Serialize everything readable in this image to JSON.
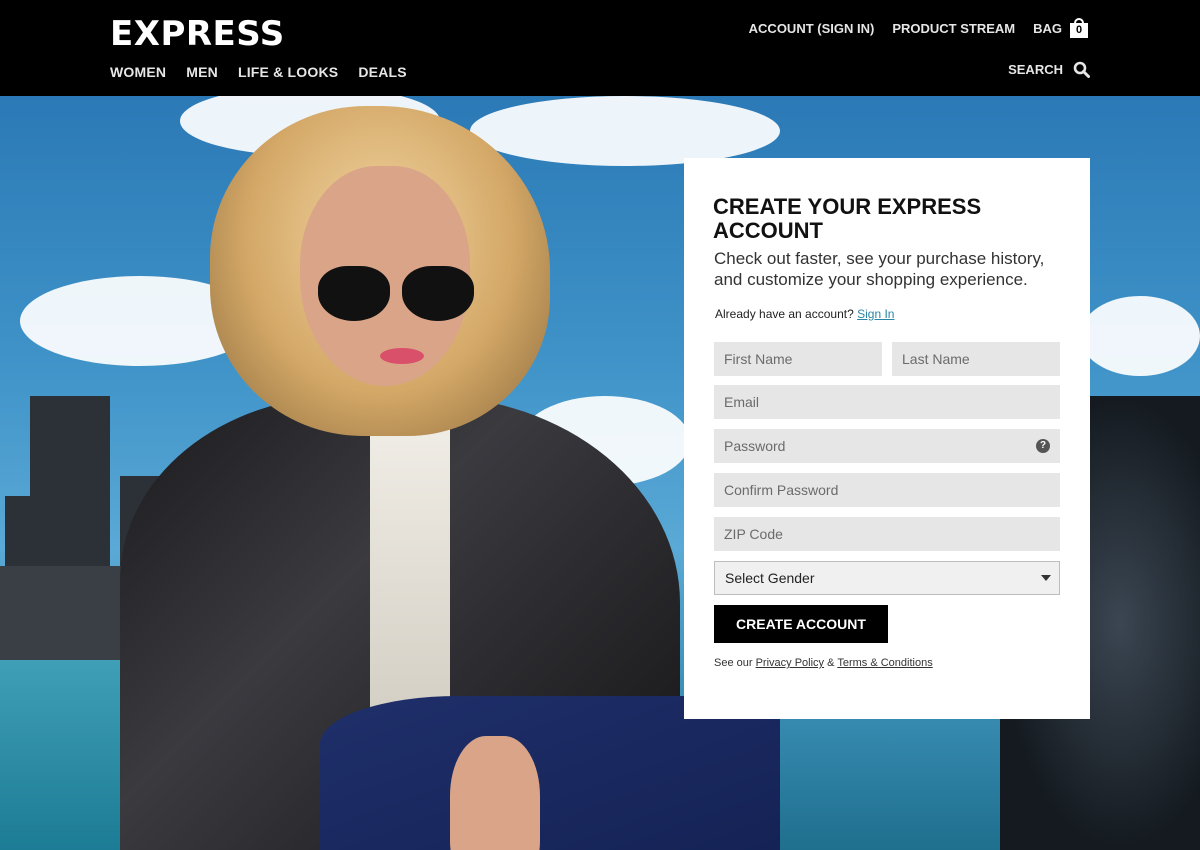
{
  "brand": {
    "logo_text": "EXPRESS"
  },
  "nav": {
    "main": [
      "WOMEN",
      "MEN",
      "LIFE & LOOKS",
      "DEALS"
    ],
    "account": "ACCOUNT (SIGN IN)",
    "product_stream": "PRODUCT STREAM",
    "bag_label": "BAG",
    "bag_count": "0",
    "search_label": "SEARCH"
  },
  "form": {
    "title": "CREATE YOUR EXPRESS ACCOUNT",
    "subtitle": "Check out faster, see your purchase history, and customize your shopping experience.",
    "already_text": "Already have an account?",
    "sign_in_link": "Sign In",
    "first_name_placeholder": "First Name",
    "last_name_placeholder": "Last Name",
    "email_placeholder": "Email",
    "password_placeholder": "Password",
    "password_help": "?",
    "confirm_password_placeholder": "Confirm Password",
    "zip_placeholder": "ZIP Code",
    "gender_selected": "Select Gender",
    "submit_label": "CREATE ACCOUNT",
    "legal_prefix": "See our",
    "privacy_link": "Privacy Policy",
    "legal_and": "&",
    "terms_link": "Terms & Conditions"
  },
  "colors": {
    "header_bg": "#000000",
    "link": "#2a85a5",
    "button_bg": "#000000",
    "field_bg": "#e6e6e6"
  }
}
